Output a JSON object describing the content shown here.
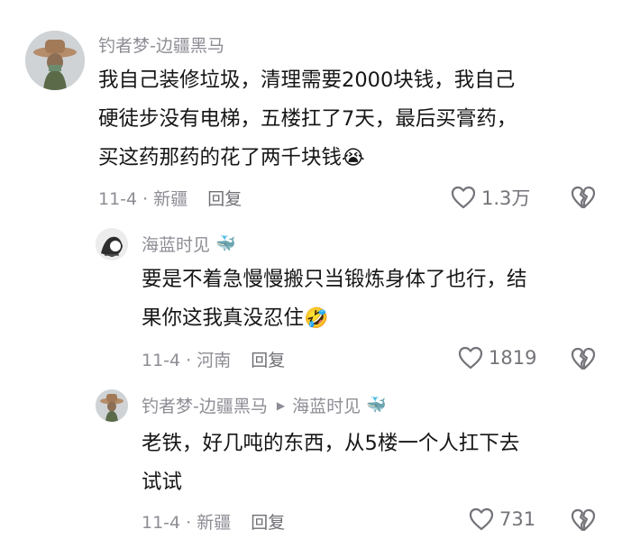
{
  "comments": [
    {
      "username": "钓者梦-边疆黑马",
      "lines": [
        "我自己装修垃圾，清理需要2000块钱，我自己",
        "硬徒步没有电梯，五楼扛了7天，最后买膏药，",
        "买这药那药的花了两千块钱"
      ],
      "emoji": "😭",
      "date_location": "11-4 · 新疆",
      "reply_label": "回复",
      "like_count": "1.3万"
    },
    {
      "username": "海蓝时见",
      "username_emoji": "🐳",
      "lines": [
        "要是不着急慢慢搬只当锻炼身体了也行，结",
        "果你这我真没忍住"
      ],
      "emoji": "🤣",
      "date_location": "11-4 · 河南",
      "reply_label": "回复",
      "like_count": "1819"
    },
    {
      "username": "钓者梦-边疆黑马",
      "reply_to": "海蓝时见",
      "reply_to_emoji": "🐳",
      "lines": [
        "老铁，好几吨的东西，从5楼一个人扛下去",
        "试试"
      ],
      "date_location": "11-4 · 新疆",
      "reply_label": "回复",
      "like_count": "731"
    }
  ],
  "icons": {
    "like": "heart-outline-icon",
    "dislike": "broken-heart-icon",
    "reply_arrow": "play-triangle-icon"
  },
  "colors": {
    "meta_text": "#8d8d95",
    "body_text": "#161616",
    "icon": "#737379"
  }
}
